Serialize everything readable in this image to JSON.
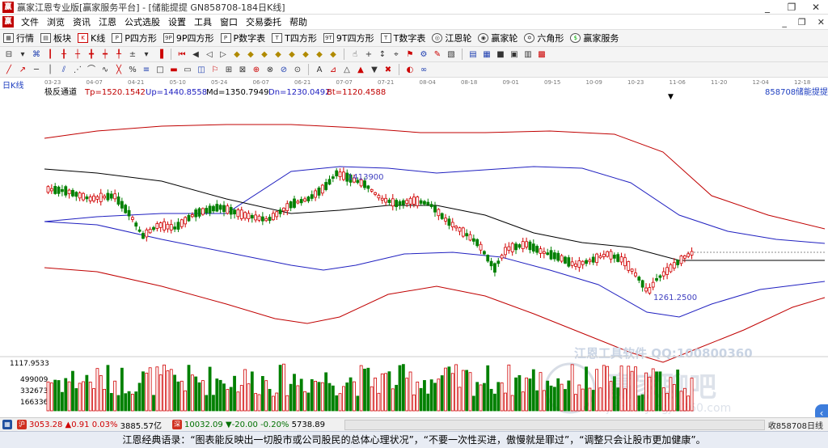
{
  "window": {
    "title": "赢家江恩专业版[赢家服务平台] - [储能提提 GN858708-184日K线]",
    "app_icon": "赢",
    "min_label": "_",
    "restore_label": "❐",
    "close_label": "✕"
  },
  "menu": {
    "app_icon": "赢",
    "items": [
      "文件",
      "浏览",
      "资讯",
      "江恩",
      "公式选股",
      "设置",
      "工具",
      "窗口",
      "交易委托",
      "帮助"
    ],
    "right": [
      "_",
      "❐",
      "✕"
    ]
  },
  "nav": [
    {
      "icon": "▦",
      "label": "行情"
    },
    {
      "icon": "▤",
      "label": "板块"
    },
    {
      "icon": "K",
      "label": "K线"
    },
    {
      "icon": "P",
      "label": "P四方形"
    },
    {
      "icon": "9P",
      "label": "9P四方形"
    },
    {
      "icon": "P",
      "label": "P数字表"
    },
    {
      "icon": "T",
      "label": "T四方形"
    },
    {
      "icon": "9T",
      "label": "9T四方形"
    },
    {
      "icon": "T",
      "label": "T数字表"
    },
    {
      "icon": "◎",
      "label": "江恩轮"
    },
    {
      "icon": "◉",
      "label": "赢家轮"
    },
    {
      "icon": "✡",
      "label": "六角形"
    },
    {
      "icon": "$",
      "label": "赢家服务"
    }
  ],
  "chart": {
    "period_label": "日K线",
    "indicator_name": "极反通道",
    "tp_label": "Tp=1520.1542",
    "up_label": "Up=1440.8558",
    "md_label": "Md=1350.7949",
    "dn_label": "Dn=1230.0492",
    "bt_label": "Bt=1120.4588",
    "code_label": "858708",
    "name_label": "储能提提",
    "high_marker": "1413900",
    "low_marker": "1261.2500",
    "volume_max_label": "1117.9533",
    "vol_ticks": [
      "499009",
      "332673",
      "166336"
    ],
    "watermark_1": "江恩工具软件 QQ:100800360",
    "watermark_2": "赢家聊吧",
    "watermark_3": "jiaoba.yingjia360.com",
    "date_ticks": [
      "03-23",
      "04-07",
      "04-21",
      "05-10",
      "05-24",
      "06-07",
      "06-21",
      "07-07",
      "07-21",
      "08-04",
      "08-18",
      "09-01",
      "09-15",
      "10-09",
      "10-23",
      "11-06",
      "11-20",
      "12-04",
      "12-18"
    ],
    "colors": {
      "up_candle": "#d00000",
      "down_candle": "#008000",
      "outer_band": "#c00000",
      "inner_band": "#2020c0",
      "mid_line": "#000000"
    }
  },
  "status": {
    "sh_badge": "沪",
    "sh_index": "3053.28",
    "sh_change": "▲0.91",
    "sh_pct": "0.03%",
    "sh_amount": "3885.57亿",
    "sz_badge": "深",
    "sz_index": "10032.09",
    "sz_change": "▼-20.00",
    "sz_pct": "-0.20%",
    "sz_amount": "5738.89",
    "right_label": "收858708日线"
  },
  "footer": {
    "quote": "江恩经典语录：“图表能反映出一切股市或公司股民的总体心理状况”，“不要一次性买进，傲慢就是罪过”，“调整只会让股市更加健康”。"
  }
}
